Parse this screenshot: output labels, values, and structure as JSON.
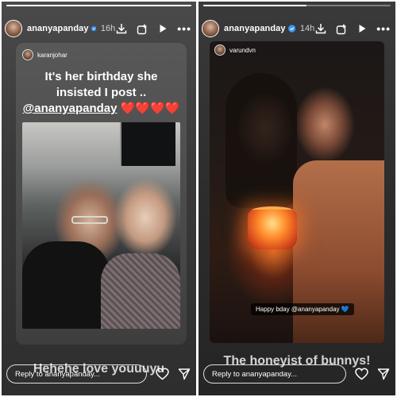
{
  "left_story": {
    "progress": 1.0,
    "username": "ananyapanday",
    "time": "16h",
    "reshared_from": "karanjohar",
    "caption_line1": "It's her birthday she",
    "caption_line2": "insisted I post ..",
    "caption_mention": "@ananyapanday",
    "caption_hearts": "❤️❤️❤️❤️",
    "overlay_text": "Hehehe love youuuyu",
    "reply_placeholder": "Reply to ananyapanday..."
  },
  "right_story": {
    "progress": 0.55,
    "username": "ananyapanday",
    "time": "14h",
    "reshared_from": "varundvn",
    "photo_label": "Happy bday @ananyapanday",
    "photo_label_emoji": "💙",
    "overlay_text": "The honeyist of bunnys!",
    "reply_placeholder": "Reply to ananyapanday..."
  },
  "icons": {
    "verified": "verified-badge-icon",
    "download": "download-icon",
    "add_to_story": "add-to-story-icon",
    "play": "play-icon",
    "more": "more-icon",
    "like": "heart-icon",
    "share": "send-icon"
  },
  "colors": {
    "verified": "#3897f0",
    "heart_red": "#e8202a"
  }
}
